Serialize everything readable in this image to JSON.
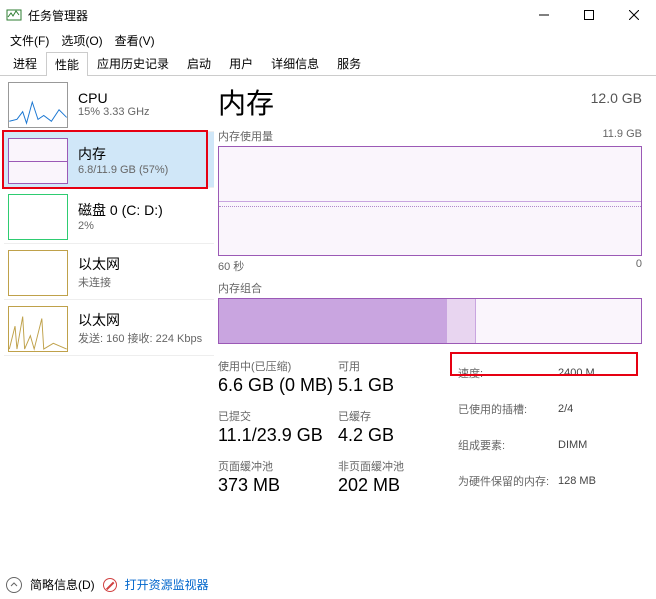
{
  "window": {
    "title": "任务管理器"
  },
  "menu": {
    "file": "文件(F)",
    "options": "选项(O)",
    "view": "查看(V)"
  },
  "tabs": {
    "processes": "进程",
    "performance": "性能",
    "app_history": "应用历史记录",
    "startup": "启动",
    "users": "用户",
    "details": "详细信息",
    "services": "服务"
  },
  "sidebar": {
    "cpu": {
      "title": "CPU",
      "sub": "15% 3.33 GHz"
    },
    "memory": {
      "title": "内存",
      "sub": "6.8/11.9 GB (57%)"
    },
    "disk": {
      "title": "磁盘 0 (C: D:)",
      "sub": "2%"
    },
    "eth0": {
      "title": "以太网",
      "sub": "未连接"
    },
    "eth1": {
      "title": "以太网",
      "sub": "发送: 160 接收: 224 Kbps"
    }
  },
  "main": {
    "title": "内存",
    "total": "12.0 GB",
    "usage_label": "内存使用量",
    "usage_max": "11.9 GB",
    "axis_left": "60 秒",
    "axis_right": "0",
    "compo_label": "内存组合",
    "details": {
      "in_use_label": "使用中(已压缩)",
      "in_use_value": "6.6 GB (0 MB)",
      "available_label": "可用",
      "available_value": "5.1 GB",
      "committed_label": "已提交",
      "committed_value": "11.1/23.9 GB",
      "cached_label": "已缓存",
      "cached_value": "4.2 GB",
      "paged_label": "页面缓冲池",
      "paged_value": "373 MB",
      "nonpaged_label": "非页面缓冲池",
      "nonpaged_value": "202 MB"
    },
    "right": {
      "speed_label": "速度:",
      "speed_value": "2400 M...",
      "slots_label": "已使用的插槽:",
      "slots_value": "2/4",
      "form_label": "组成要素:",
      "form_value": "DIMM",
      "reserved_label": "为硬件保留的内存:",
      "reserved_value": "128 MB"
    }
  },
  "footer": {
    "fewer": "简略信息(D)",
    "resmon": "打开资源监视器"
  }
}
